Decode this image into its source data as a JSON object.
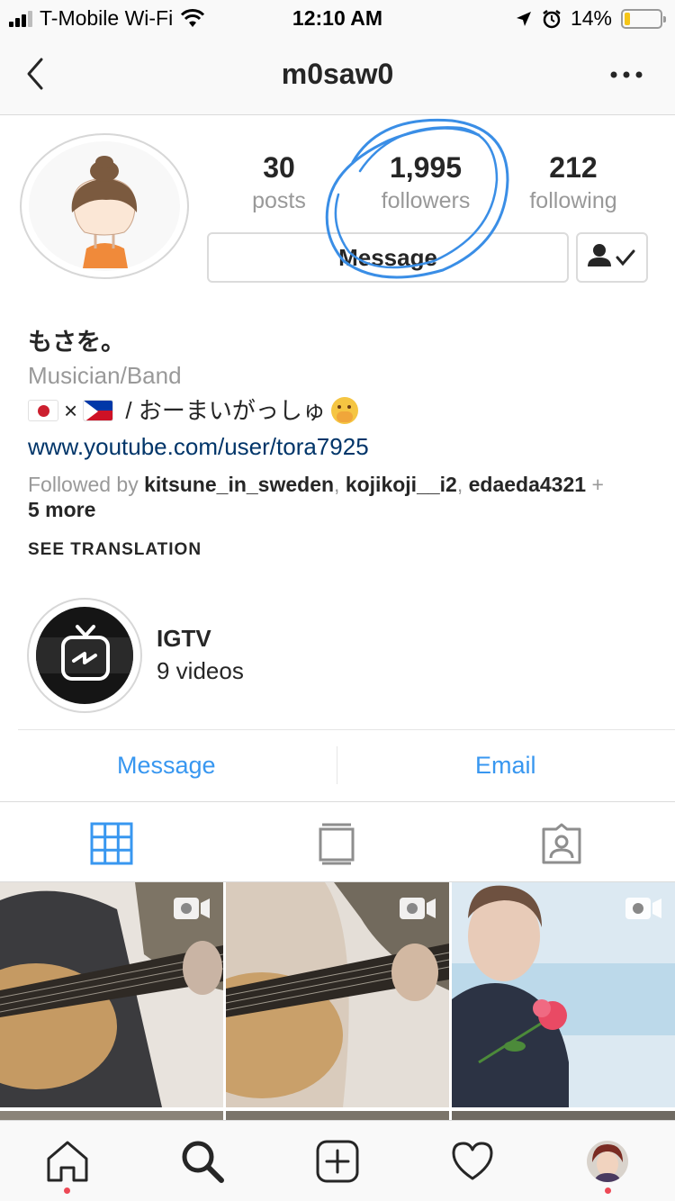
{
  "status_bar": {
    "carrier": "T-Mobile Wi-Fi",
    "time": "12:10 AM",
    "battery_percent": "14%",
    "battery_level": 0.14,
    "icons": [
      "signal-icon",
      "wifi-icon",
      "location-arrow-icon",
      "alarm-icon",
      "battery-icon"
    ]
  },
  "nav": {
    "title": "m0saw0",
    "back_icon": "chevron-left-icon",
    "more_icon": "more-horizontal-icon"
  },
  "profile": {
    "stats": [
      {
        "value": "30",
        "label": "posts"
      },
      {
        "value": "1,995",
        "label": "followers"
      },
      {
        "value": "212",
        "label": "following"
      }
    ],
    "message_button": "Message",
    "follow_icon": "following-check-icon",
    "name": "もさを。",
    "category": "Musician/Band",
    "bio_separator": "×",
    "bio_text": " / おーまいがっしゅ",
    "website": "www.youtube.com/user/tora7925",
    "followed_by_prefix": "Followed by ",
    "followed_by": [
      "kitsune_in_sweden",
      "kojikoji__i2",
      "edaeda4321"
    ],
    "followed_by_comma": ", ",
    "followed_by_suffix": " + ",
    "followed_by_more": "5 more",
    "see_translation": "SEE TRANSLATION"
  },
  "highlight": {
    "title": "IGTV",
    "count": "9 videos"
  },
  "contact": {
    "message": "Message",
    "email": "Email"
  },
  "colors": {
    "accent": "#3897f0",
    "link": "#003569",
    "muted": "#999999",
    "text": "#262626",
    "annotation": "#3a8ee6",
    "notification": "#ed4956"
  },
  "tab_bar": {
    "icons": [
      "home-icon",
      "search-icon",
      "new-post-icon",
      "activity-heart-icon",
      "profile-avatar"
    ]
  }
}
